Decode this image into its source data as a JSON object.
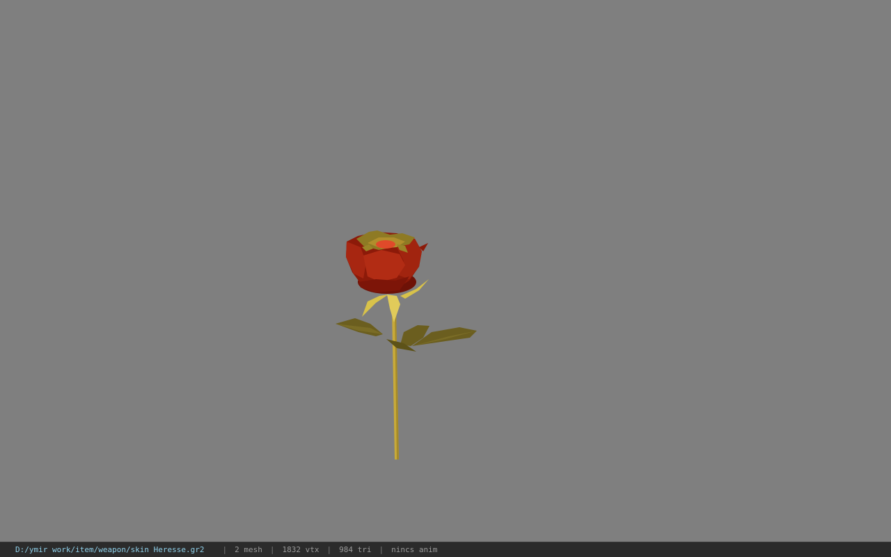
{
  "viewer": {
    "background_color": "#7f7f7f",
    "model_name": "rose"
  },
  "status": {
    "file_path": "D:/ymir work/item/weapon/skin Heresse.gr2",
    "separator": "|",
    "mesh": "2 mesh",
    "vertices": "1832 vtx",
    "triangles": "984 tri",
    "anim": "nincs anim"
  }
}
